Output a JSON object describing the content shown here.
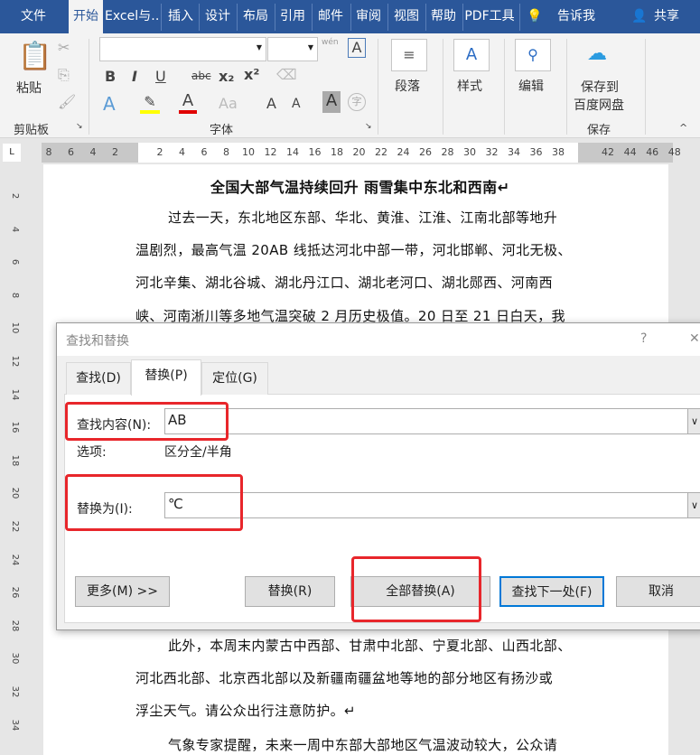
{
  "tabs": [
    "文件",
    "开始",
    "Excel与…",
    "插入",
    "设计",
    "布局",
    "引用",
    "邮件",
    "审阅",
    "视图",
    "帮助",
    "PDF工具"
  ],
  "tell_me": "告诉我",
  "share": "共享",
  "ribbon": {
    "paste": "粘贴",
    "clipboard": "剪贴板",
    "font_group": "字体",
    "paragraph": "段落",
    "styles": "样式",
    "editing": "编辑",
    "save_to": "保存到",
    "baidu": "百度网盘",
    "save_group": "保存",
    "bold": "B",
    "italic": "I",
    "underline": "U",
    "strike": "abc",
    "sub": "x₂",
    "sup": "x²",
    "font_color": "A",
    "aa": "Aa",
    "grow": "A",
    "shrink": "A",
    "wen": "wén"
  },
  "ruler": {
    "left": [
      "8",
      "6",
      "4",
      "2"
    ],
    "main": [
      "2",
      "4",
      "6",
      "8",
      "10",
      "12",
      "14",
      "16",
      "18",
      "20",
      "22",
      "24",
      "26",
      "28",
      "30",
      "32",
      "34",
      "36",
      "38"
    ],
    "right": [
      "42",
      "44",
      "46",
      "48"
    ]
  },
  "vruler": [
    "2",
    "4",
    "6",
    "8",
    "10",
    "12",
    "14",
    "16",
    "18",
    "20",
    "22",
    "24",
    "26",
    "28",
    "30",
    "32",
    "34"
  ],
  "doc": {
    "title": "全国大部气温持续回升  雨雪集中东北和西南↵",
    "lines": [
      "过去一天，东北地区东部、华北、黄淮、江淮、江南北部等地升",
      "温剧烈，最高气温 20AB 线抵达河北中部一带，河北邯郸、河北无极、",
      "河北辛集、湖北谷城、湖北丹江口、湖北老河口、湖北郧西、河南西",
      "峡、河南淅川等多地气温突破 2 月历史极值。20 日至 21 日白天，我"
    ],
    "lines2": [
      "此外，本周末内蒙古中西部、甘肃中北部、宁夏北部、山西北部、",
      "河北西北部、北京西北部以及新疆南疆盆地等地的部分地区有扬沙或",
      "浮尘天气。请公众出行注意防护。↵",
      "气象专家提醒，未来一周中东部大部地区气温波动较大，公众请"
    ]
  },
  "dialog": {
    "title": "查找和替换",
    "help": "?",
    "close": "✕",
    "tabs": [
      "查找(D)",
      "替换(P)",
      "定位(G)"
    ],
    "find_label": "查找内容(N):",
    "find_value": "AB",
    "options_label": "选项:",
    "options_value": "区分全/半角",
    "replace_label": "替换为(I):",
    "replace_value": "℃",
    "buttons": {
      "more": "更多(M) >>",
      "replace": "替换(R)",
      "replace_all": "全部替换(A)",
      "find_next": "查找下一处(F)",
      "cancel": "取消"
    }
  },
  "colors": {
    "brand": "#2b579a",
    "highlight": "#e8262b"
  }
}
